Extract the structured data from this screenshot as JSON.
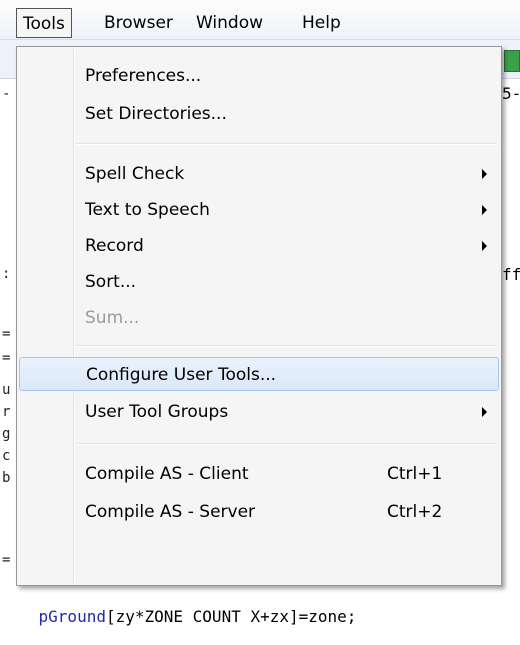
{
  "menubar": {
    "items": [
      "Tools",
      "Browser",
      "Window",
      "Help"
    ]
  },
  "editor": {
    "visible_code": [
      "5-",
      "ff",
      "pGround[zy*ZONE_COUNT_X+zx]=zone;"
    ]
  },
  "tools_menu": {
    "items": [
      {
        "label": "Preferences...",
        "shortcut": "",
        "submenu": false,
        "enabled": true
      },
      {
        "label": "Set Directories...",
        "shortcut": "",
        "submenu": false,
        "enabled": true
      },
      {
        "label": "Spell Check",
        "shortcut": "",
        "submenu": true,
        "enabled": true
      },
      {
        "label": "Text to Speech",
        "shortcut": "",
        "submenu": true,
        "enabled": true
      },
      {
        "label": "Record",
        "shortcut": "",
        "submenu": true,
        "enabled": true
      },
      {
        "label": "Sort...",
        "shortcut": "",
        "submenu": false,
        "enabled": true
      },
      {
        "label": "Sum...",
        "shortcut": "",
        "submenu": false,
        "enabled": false
      },
      {
        "label": "Configure User Tools...",
        "shortcut": "",
        "submenu": false,
        "enabled": true,
        "highlighted": true
      },
      {
        "label": "User Tool Groups",
        "shortcut": "",
        "submenu": true,
        "enabled": true
      },
      {
        "label": "Compile AS - Client",
        "shortcut": "Ctrl+1",
        "submenu": false,
        "enabled": true
      },
      {
        "label": "Compile AS - Server",
        "shortcut": "Ctrl+2",
        "submenu": false,
        "enabled": true
      }
    ]
  }
}
